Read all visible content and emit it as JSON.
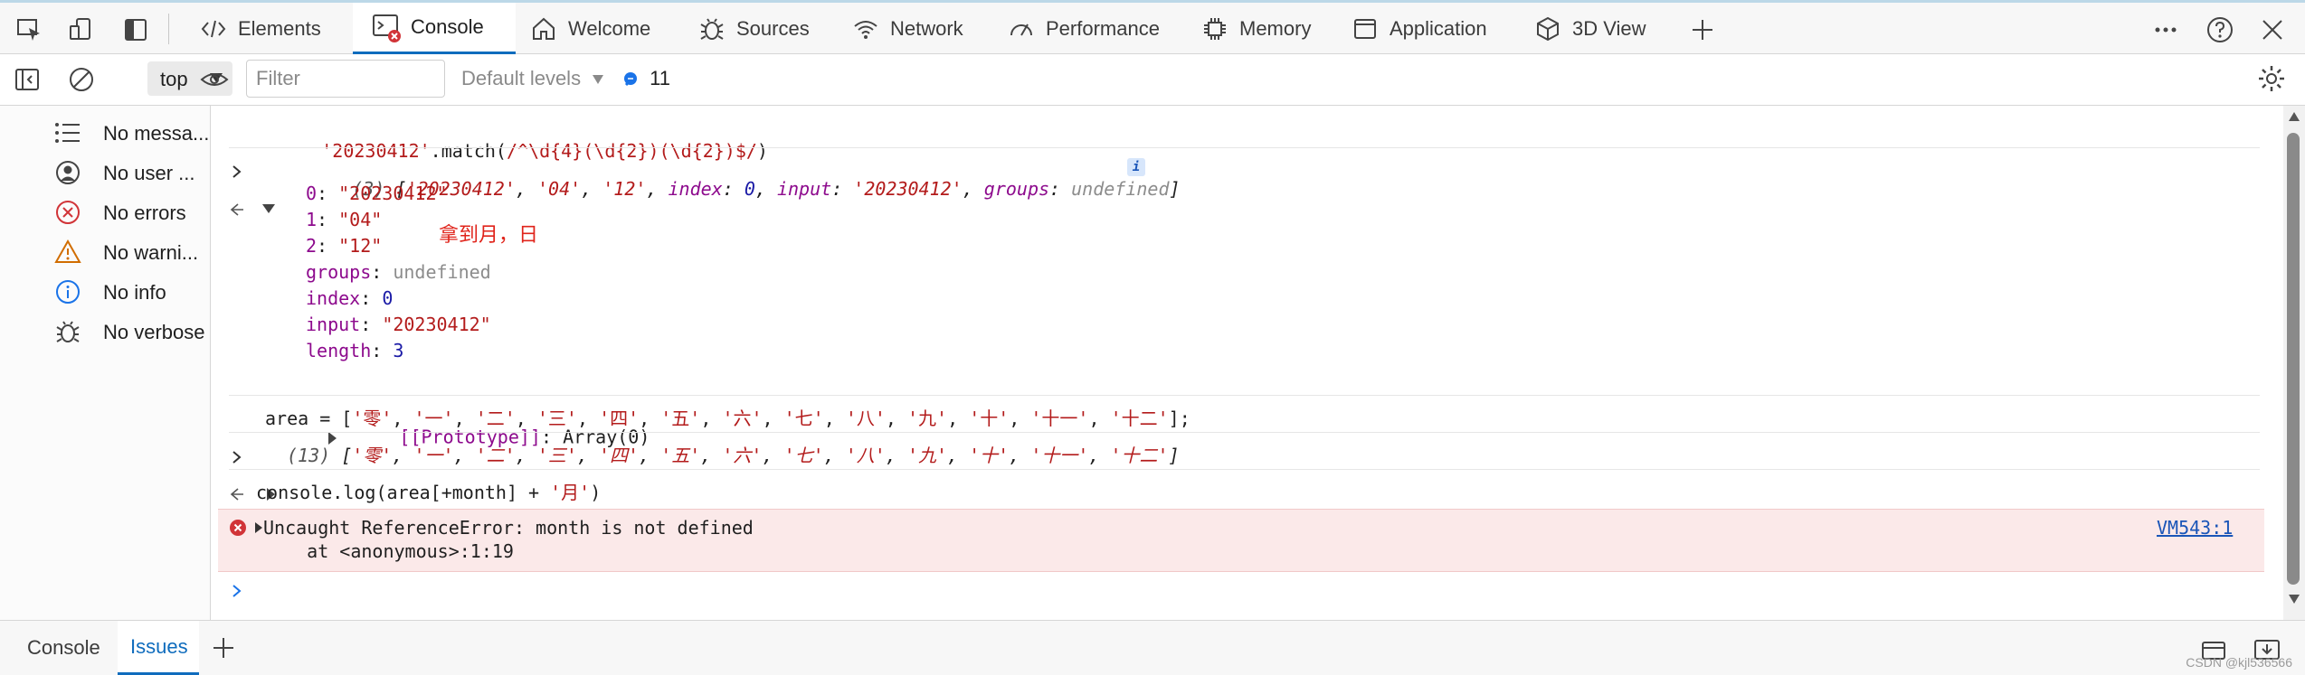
{
  "tabs": [
    {
      "label": "Elements",
      "icon": "code-icon"
    },
    {
      "label": "Console",
      "icon": "console-icon",
      "active": true
    },
    {
      "label": "Welcome",
      "icon": "home-icon"
    },
    {
      "label": "Sources",
      "icon": "bug-icon"
    },
    {
      "label": "Network",
      "icon": "wifi-icon"
    },
    {
      "label": "Performance",
      "icon": "gauge-icon"
    },
    {
      "label": "Memory",
      "icon": "chip-icon"
    },
    {
      "label": "Application",
      "icon": "window-icon"
    },
    {
      "label": "3D View",
      "icon": "cube-icon"
    }
  ],
  "toolbar": {
    "context": "top",
    "filter_placeholder": "Filter",
    "levels": "Default levels",
    "issues_count": "11"
  },
  "sidebar": [
    {
      "label": "No messa...",
      "icon": "list-icon"
    },
    {
      "label": "No user ...",
      "icon": "user-icon"
    },
    {
      "label": "No errors",
      "icon": "error-icon"
    },
    {
      "label": "No warni...",
      "icon": "warning-icon"
    },
    {
      "label": "No info",
      "icon": "info-icon"
    },
    {
      "label": "No verbose",
      "icon": "bug-icon"
    }
  ],
  "console": {
    "input1": {
      "str": "'20230412'",
      "mid": ".match(",
      "regex": "/^\\d{4}(\\d{2})(\\d{2})$/",
      "end": ")"
    },
    "result1": {
      "count": "(3)",
      "preview_open": "[",
      "v0": "'20230412'",
      "v1": "'04'",
      "v2": "'12'",
      "k_index": "index",
      "v_index": "0",
      "k_input": "input",
      "v_input": "'20230412'",
      "k_groups": "groups",
      "v_groups": "undefined",
      "preview_close": "]",
      "info_badge": "i",
      "props": [
        {
          "key": "0",
          "value": "\"20230412\""
        },
        {
          "key": "1",
          "value": "\"04\""
        },
        {
          "key": "2",
          "value": "\"12\""
        },
        {
          "key": "groups",
          "value": "undefined"
        },
        {
          "key": "index",
          "value": "0"
        },
        {
          "key": "input",
          "value": "\"20230412\""
        },
        {
          "key": "length",
          "value": "3"
        }
      ],
      "prototype_key": "[[Prototype]]",
      "prototype_value": "Array(0)"
    },
    "annotation": "拿到月，日",
    "input2": {
      "text": "area = [",
      "items": [
        "'零'",
        "'一'",
        "'二'",
        "'三'",
        "'四'",
        "'五'",
        "'六'",
        "'七'",
        "'八'",
        "'九'",
        "'十'",
        "'十一'",
        "'十二'"
      ],
      "end": "];"
    },
    "result2": {
      "count": "(13)",
      "items": [
        "'零'",
        "'一'",
        "'二'",
        "'三'",
        "'四'",
        "'五'",
        "'六'",
        "'七'",
        "'八'",
        "'九'",
        "'十'",
        "'十一'",
        "'十二'"
      ]
    },
    "input3": {
      "text": "console.log(area[+month] + ",
      "str": "'月'",
      "end": ")"
    },
    "error": {
      "message": "Uncaught ReferenceError: month is not defined",
      "stack": "    at <anonymous>:1:19",
      "source": "VM543:1"
    }
  },
  "drawer": {
    "tabs": [
      {
        "label": "Console"
      },
      {
        "label": "Issues",
        "active": true
      }
    ]
  },
  "watermark": "CSDN @kjl536566"
}
